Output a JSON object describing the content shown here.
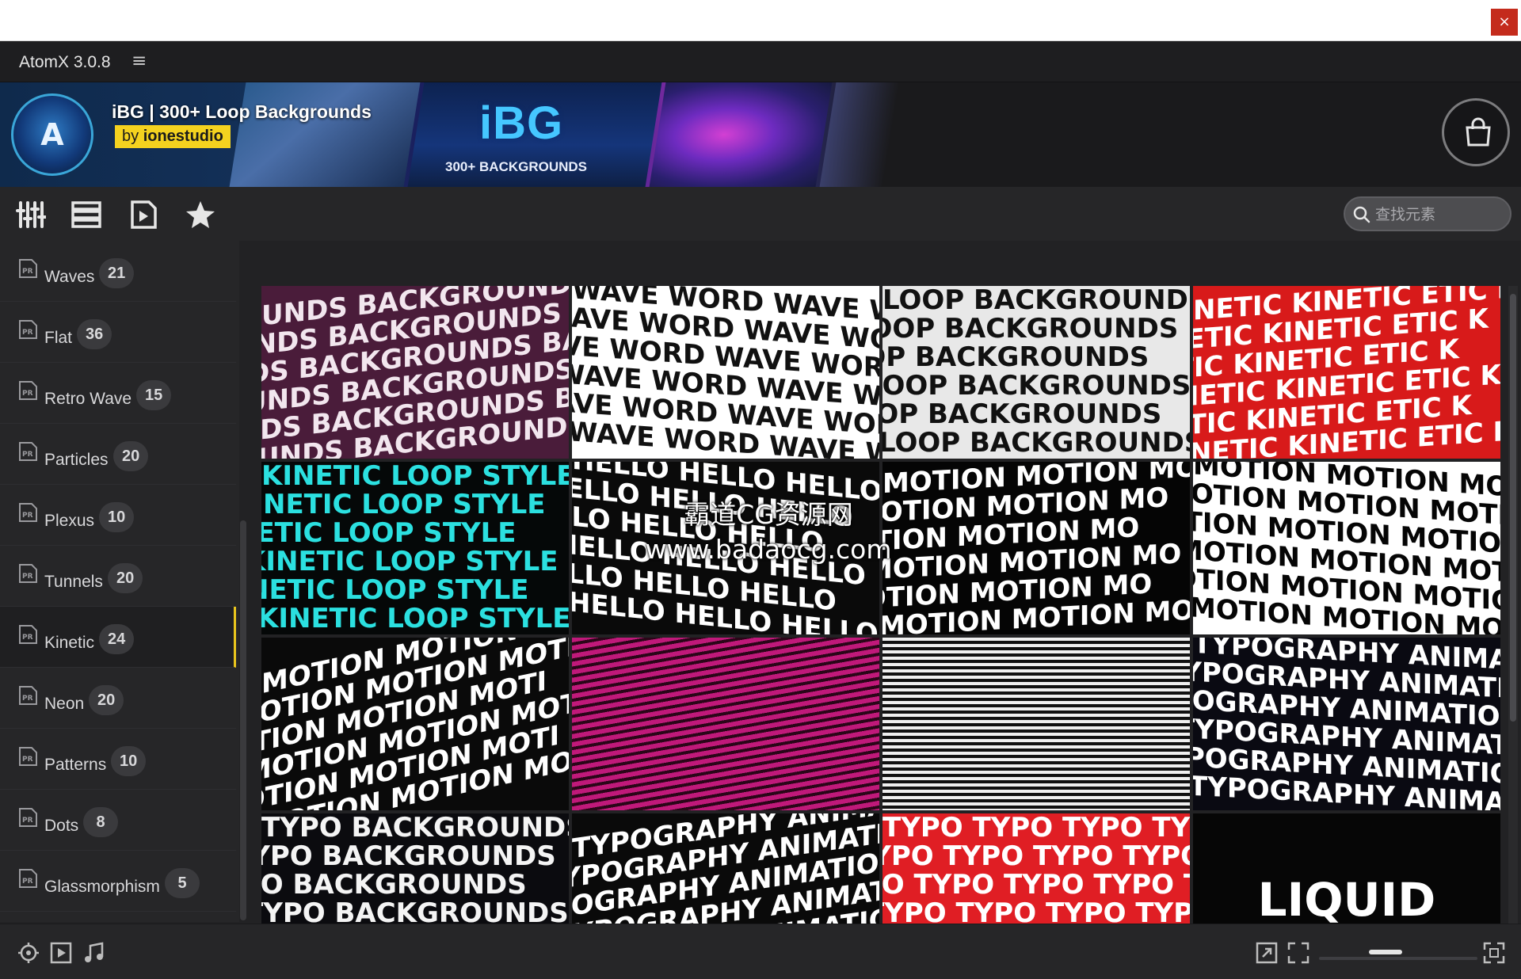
{
  "window": {
    "close_glyph": "×"
  },
  "app": {
    "title": "AtomX 3.0.8",
    "menu_glyph": "≡"
  },
  "banner": {
    "title": "iBG | 300+ Loop Backgrounds",
    "by_prefix": "by ",
    "by_author": "ionestudio",
    "logo_glyph": "A",
    "art_title": "iBG",
    "art_subtitle": "300+ BACKGROUNDS",
    "shop_icon": "shopping-bag-icon"
  },
  "toolbar": {
    "tools": [
      {
        "name": "filters-icon"
      },
      {
        "name": "list-view-icon"
      },
      {
        "name": "preview-icon"
      },
      {
        "name": "favorites-icon"
      }
    ],
    "search_placeholder": "查找元素"
  },
  "sidebar": {
    "items": [
      {
        "label": "Waves",
        "count": "21",
        "active": false
      },
      {
        "label": "Flat",
        "count": "36",
        "active": false
      },
      {
        "label": "Retro Wave",
        "count": "15",
        "active": false
      },
      {
        "label": "Particles",
        "count": "20",
        "active": false
      },
      {
        "label": "Plexus",
        "count": "10",
        "active": false
      },
      {
        "label": "Tunnels",
        "count": "20",
        "active": false
      },
      {
        "label": "Kinetic",
        "count": "24",
        "active": true
      },
      {
        "label": "Neon",
        "count": "20",
        "active": false
      },
      {
        "label": "Patterns",
        "count": "10",
        "active": false
      },
      {
        "label": "Dots",
        "count": "8",
        "active": false
      },
      {
        "label": "Glassmorphism",
        "count": "5",
        "active": false
      }
    ]
  },
  "grid": {
    "tiles": [
      {
        "text": "UNDS BACKGROUNDS BAC",
        "bg": "#4a1c3a",
        "fg": "#f2e6ee"
      },
      {
        "text": "WAVE WORD WAVE WORD",
        "bg": "#ffffff",
        "fg": "#111111"
      },
      {
        "text": "LOOP BACKGROUNDS",
        "bg": "#e8e8e8",
        "fg": "#111111"
      },
      {
        "text": "NETIC KINETIC ETIC K",
        "bg": "#d81a1a",
        "fg": "#ffffff"
      },
      {
        "text": "KINETIC LOOP STYLE",
        "bg": "#050808",
        "fg": "#2be0e0"
      },
      {
        "text": "HELLO HELLO HELLO",
        "bg": "#0a0a0a",
        "fg": "#ffffff"
      },
      {
        "text": "MOTION MOTION MO",
        "bg": "#050505",
        "fg": "#ffffff"
      },
      {
        "text": "MOTION MOTION MOTION",
        "bg": "#ffffff",
        "fg": "#050505"
      },
      {
        "text": "MOTION MOTION MOTI",
        "bg": "#0a0a0a",
        "fg": "#ffffff"
      },
      {
        "text": "",
        "bg": "#c0197a",
        "fg": "#2a0618"
      },
      {
        "text": "",
        "bg": "#d8d8d8",
        "fg": "#101010"
      },
      {
        "text": "TYPOGRAPHY ANIMATION",
        "bg": "#0a0a12",
        "fg": "#ffffff"
      },
      {
        "text": "TYPO BACKGROUNDS",
        "bg": "#0b0b0f",
        "fg": "#f4f4f4"
      },
      {
        "text": "TYPOGRAPHY ANIMATION",
        "bg": "#0a0a0a",
        "fg": "#ffffff"
      },
      {
        "text": "TYPO TYPO TYPO TYPO TYPO",
        "bg": "#e01e24",
        "fg": "#ffffff"
      },
      {
        "text": "LIQUID",
        "bg": "#060606",
        "fg": "#ffffff"
      }
    ]
  },
  "watermark": {
    "line1": "霸道CG资源网",
    "line2": "www.badaocg.com"
  },
  "bottombar": {
    "left_icons": [
      "target-icon",
      "play-icon",
      "music-icon"
    ],
    "right_icons": [
      "external-link-icon",
      "fit-icon",
      "fullscreen-icon"
    ],
    "zoom_level": 0.4
  }
}
